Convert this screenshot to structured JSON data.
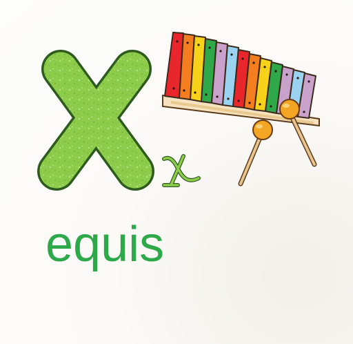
{
  "card": {
    "word": "equis"
  },
  "colors": {
    "letter_green": "#8ccc4a",
    "letter_outline": "#2e5a1e",
    "word_green": "#2ea94a",
    "xylophone_bars": [
      "#e8262c",
      "#f47d20",
      "#f7d21a",
      "#2fa84a",
      "#c9a2cc",
      "#9ad3ef",
      "#e8262c",
      "#f47d20",
      "#f7d21a",
      "#2fa84a",
      "#c9a2cc",
      "#9ad3ef",
      "#c9a2cc"
    ],
    "mallet_head": "#f3a623"
  },
  "icons": {
    "uppercase_letter": "letter-x-uppercase-icon",
    "lowercase_letter": "letter-x-lowercase-icon",
    "instrument": "xylophone-icon"
  }
}
